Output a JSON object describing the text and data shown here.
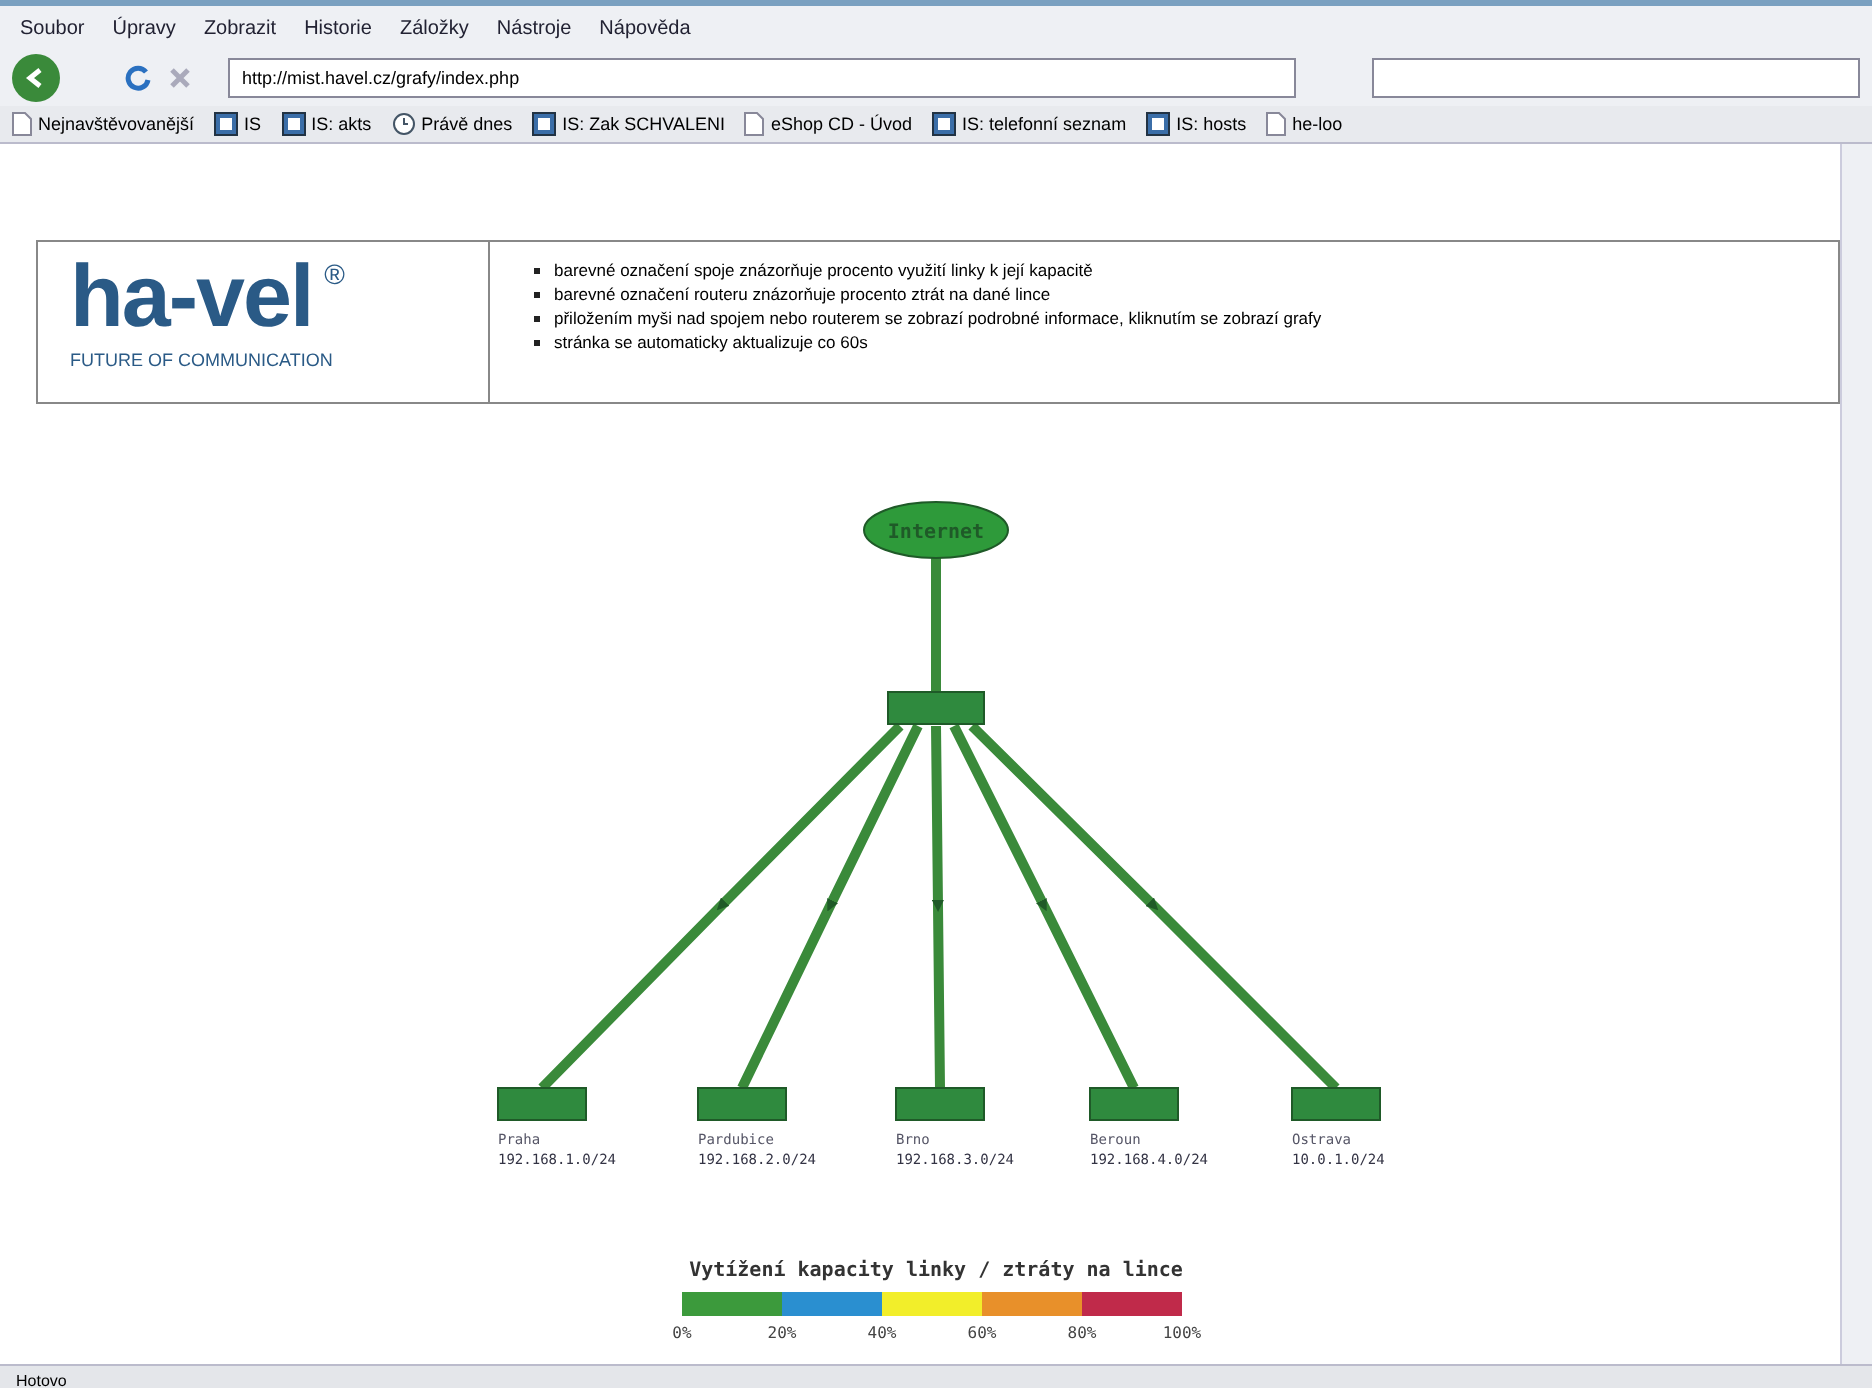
{
  "menu": [
    "Soubor",
    "Úpravy",
    "Zobrazit",
    "Historie",
    "Záložky",
    "Nástroje",
    "Nápověda"
  ],
  "address": {
    "value": "http://mist.havel.cz/grafy/index.php"
  },
  "bookmarks": [
    {
      "label": "Nejnavštěvovanější",
      "kind": "page"
    },
    {
      "label": "IS",
      "kind": "app"
    },
    {
      "label": "IS: akts",
      "kind": "app"
    },
    {
      "label": "Právě dnes",
      "kind": "feed"
    },
    {
      "label": "IS: Zak SCHVALENI",
      "kind": "app"
    },
    {
      "label": "eShop CD - Úvod",
      "kind": "page"
    },
    {
      "label": "IS: telefonní seznam",
      "kind": "app"
    },
    {
      "label": "IS: hosts",
      "kind": "app"
    },
    {
      "label": "he-loo",
      "kind": "page"
    }
  ],
  "logo": {
    "name": "ha-vel",
    "mark": "®",
    "tagline": "FUTURE OF COMMUNICATION"
  },
  "notes": [
    "barevné označení spoje znázorňuje procento využití linky k její kapacitě",
    "barevné označení routeru znázorňuje procento ztrát na dané lince",
    "přiložením myši nad spojem nebo routerem se zobrazí podrobné informace, kliknutím se zobrazí grafy",
    "stránka se automaticky aktualizuje co 60s"
  ],
  "diagram": {
    "root": {
      "label": "Internet",
      "color": "#2e9a3a"
    },
    "core": {
      "color": "#2f8a3e"
    },
    "sites": [
      {
        "name": "Praha",
        "network": "192.168.1.0/24",
        "color": "#2f8a3e"
      },
      {
        "name": "Pardubice",
        "network": "192.168.2.0/24",
        "color": "#2f8a3e"
      },
      {
        "name": "Brno",
        "network": "192.168.3.0/24",
        "color": "#2f8a3e"
      },
      {
        "name": "Beroun",
        "network": "192.168.4.0/24",
        "color": "#2f8a3e"
      },
      {
        "name": "Ostrava",
        "network": "10.0.1.0/24",
        "color": "#2f8a3e"
      }
    ]
  },
  "legend": {
    "title": "Vytížení kapacity linky / ztráty na lince",
    "segments": [
      {
        "color": "#3c9a3c"
      },
      {
        "color": "#2a8fd0"
      },
      {
        "color": "#f2ee2a"
      },
      {
        "color": "#e8902a"
      },
      {
        "color": "#c02a4a"
      }
    ],
    "ticks": [
      "0%",
      "20%",
      "40%",
      "60%",
      "80%",
      "100%"
    ]
  },
  "status_bar": {
    "text": "Hotovo"
  }
}
